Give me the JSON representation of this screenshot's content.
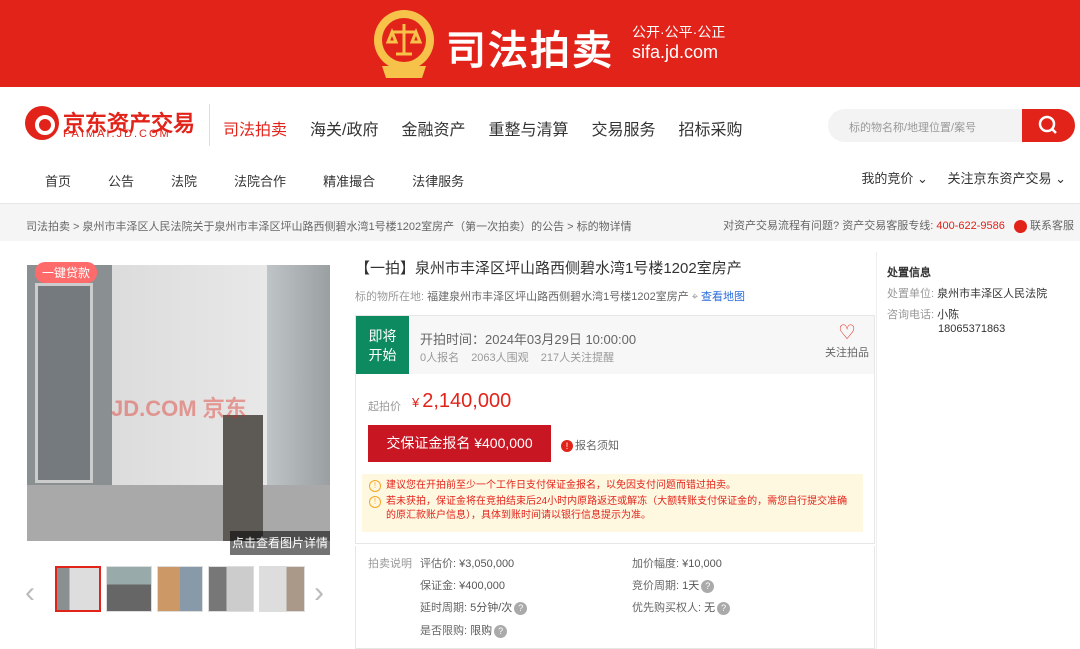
{
  "banner": {
    "title": "司法拍卖",
    "slogan": "公开·公平·公正",
    "domain": "sifa.jd.com"
  },
  "logo": {
    "name": "京东资产交易",
    "sub": "PAIMAI.JD.COM"
  },
  "nav": {
    "items": [
      "司法拍卖",
      "海关/政府",
      "金融资产",
      "重整与清算",
      "交易服务",
      "招标采购"
    ]
  },
  "search": {
    "placeholder": "标的物名称/地理位置/案号"
  },
  "subnav": {
    "items": [
      "首页",
      "公告",
      "法院",
      "法院合作",
      "精准撮合",
      "法律服务"
    ]
  },
  "usernav": {
    "my_bids": "我的竞价 ⌄",
    "follow": "关注京东资产交易 ⌄"
  },
  "breadcrumb": {
    "text": "司法拍卖 > 泉州市丰泽区人民法院关于泉州市丰泽区坪山路西侧碧水湾1号楼1202室房产（第一次拍卖）的公告 > 标的物详情"
  },
  "help": {
    "text": "对资产交易流程有问题? 资产交易客服专线:",
    "phone": "400-622-9586",
    "service": "联系客服"
  },
  "gallery": {
    "loan_tag": "一键贷款",
    "detail_link": "点击查看图片详情",
    "watermark": "JD.COM 京东"
  },
  "item": {
    "title": "【一拍】泉州市丰泽区坪山路西侧碧水湾1号楼1202室房产",
    "location_label": "标的物所在地:",
    "location": "福建泉州市丰泽区坪山路西侧碧水湾1号楼1202室房产",
    "map_link": "查看地图",
    "status_line1": "即将",
    "status_line2": "开始",
    "start_time": "开拍时间：2024年03月29日 10:00:00",
    "signups": "0人报名",
    "views": "2063人围观",
    "reminders": "217人关注提醒",
    "follow_label": "关注拍品",
    "price_label": "起拍价",
    "price_symbol": "¥",
    "price": "2,140,000",
    "deposit_button": "交保证金报名 ¥400,000",
    "notice": "报名须知",
    "tip1": "建议您在开拍前至少一个工作日支付保证金报名，以免因支付问题而错过拍卖。",
    "tip2": "若未获拍，保证金将在竞拍结束后24小时内原路返还或解冻（大额转账支付保证金的，需您自行提交准确的原汇款账户信息），具体到账时间请以银行信息提示为准。"
  },
  "rules": {
    "label": "拍卖说明",
    "appraisal_k": "评估价:",
    "appraisal_v": "¥3,050,000",
    "deposit_k": "保证金:",
    "deposit_v": "¥400,000",
    "delay_k": "延时周期:",
    "delay_v": "5分钟/次",
    "limit_k": "是否限购:",
    "limit_v": "限购",
    "increment_k": "加价幅度:",
    "increment_v": "¥10,000",
    "cycle_k": "竞价周期:",
    "cycle_v": "1天",
    "priority_k": "优先购买权人:",
    "priority_v": "无"
  },
  "side": {
    "title": "处置信息",
    "unit_k": "处置单位:",
    "unit_v": "泉州市丰泽区人民法院",
    "phone_k": "咨询电话:",
    "contact": "小陈",
    "phone": "18065371863"
  },
  "colors": {
    "brand_red": "#e2231a",
    "status_green": "#0e8a61"
  }
}
